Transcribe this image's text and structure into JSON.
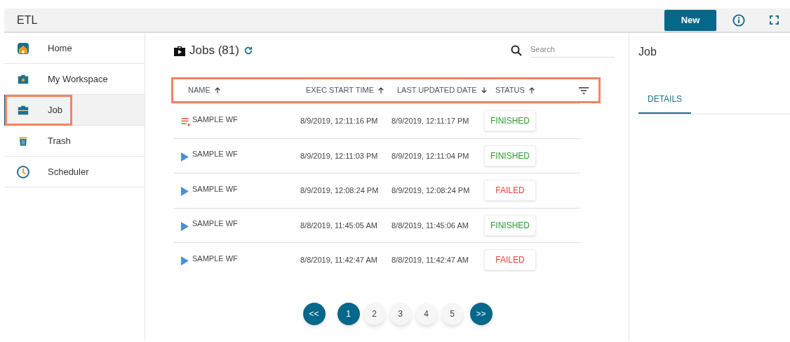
{
  "app_bar": {
    "title": "ETL",
    "new_button": "New"
  },
  "sidebar": {
    "items": [
      {
        "label": "Home",
        "kind": "home",
        "selected": false,
        "highlighted": false
      },
      {
        "label": "My Workspace",
        "kind": "workspace",
        "selected": false,
        "highlighted": false
      },
      {
        "label": "Job",
        "kind": "job",
        "selected": true,
        "highlighted": true
      },
      {
        "label": "Trash",
        "kind": "trash",
        "selected": false,
        "highlighted": false
      },
      {
        "label": "Scheduler",
        "kind": "clock",
        "selected": false,
        "highlighted": false
      }
    ]
  },
  "jobs": {
    "title": "Jobs (81)",
    "search": {
      "placeholder": "Search"
    },
    "header_highlighted": true,
    "columns": [
      {
        "label": "NAME",
        "descending": false
      },
      {
        "label": "EXEC START TIME",
        "descending": false
      },
      {
        "label": "LAST UPDATED DATE",
        "descending": true
      },
      {
        "label": "STATUS",
        "descending": false
      }
    ],
    "rows": [
      {
        "kind": "running",
        "name": "SAMPLE WF",
        "start": "8/9/2019, 12:11:16 PM",
        "updated": "8/9/2019, 12:11:17 PM",
        "status": "FINISHED",
        "color": "#2e9a2e"
      },
      {
        "kind": "play",
        "name": "SAMPLE WF",
        "start": "8/9/2019, 12:11:03 PM",
        "updated": "8/9/2019, 12:11:04 PM",
        "status": "FINISHED",
        "color": "#2e9a2e"
      },
      {
        "kind": "play",
        "name": "SAMPLE WF",
        "start": "8/9/2019, 12:08:24 PM",
        "updated": "8/9/2019, 12:08:24 PM",
        "status": "FAILED",
        "color": "#f03c3c"
      },
      {
        "kind": "play",
        "name": "SAMPLE WF",
        "start": "8/8/2019, 11:45:05 AM",
        "updated": "8/8/2019, 11:45:06 AM",
        "status": "FINISHED",
        "color": "#2e9a2e"
      },
      {
        "kind": "play",
        "name": "SAMPLE WF",
        "start": "8/8/2019, 11:42:47 AM",
        "updated": "8/8/2019, 11:42:47 AM",
        "status": "FAILED",
        "color": "#f03c3c"
      }
    ],
    "pagination": {
      "first": "<<",
      "last": ">>",
      "pages": [
        {
          "label": "1",
          "selected": true
        },
        {
          "label": "2",
          "selected": false
        },
        {
          "label": "3",
          "selected": false
        },
        {
          "label": "4",
          "selected": false
        },
        {
          "label": "5",
          "selected": false
        }
      ]
    }
  },
  "detail_panel": {
    "title": "Job",
    "tabs": [
      {
        "label": "DETAILS",
        "selected": true
      }
    ]
  }
}
